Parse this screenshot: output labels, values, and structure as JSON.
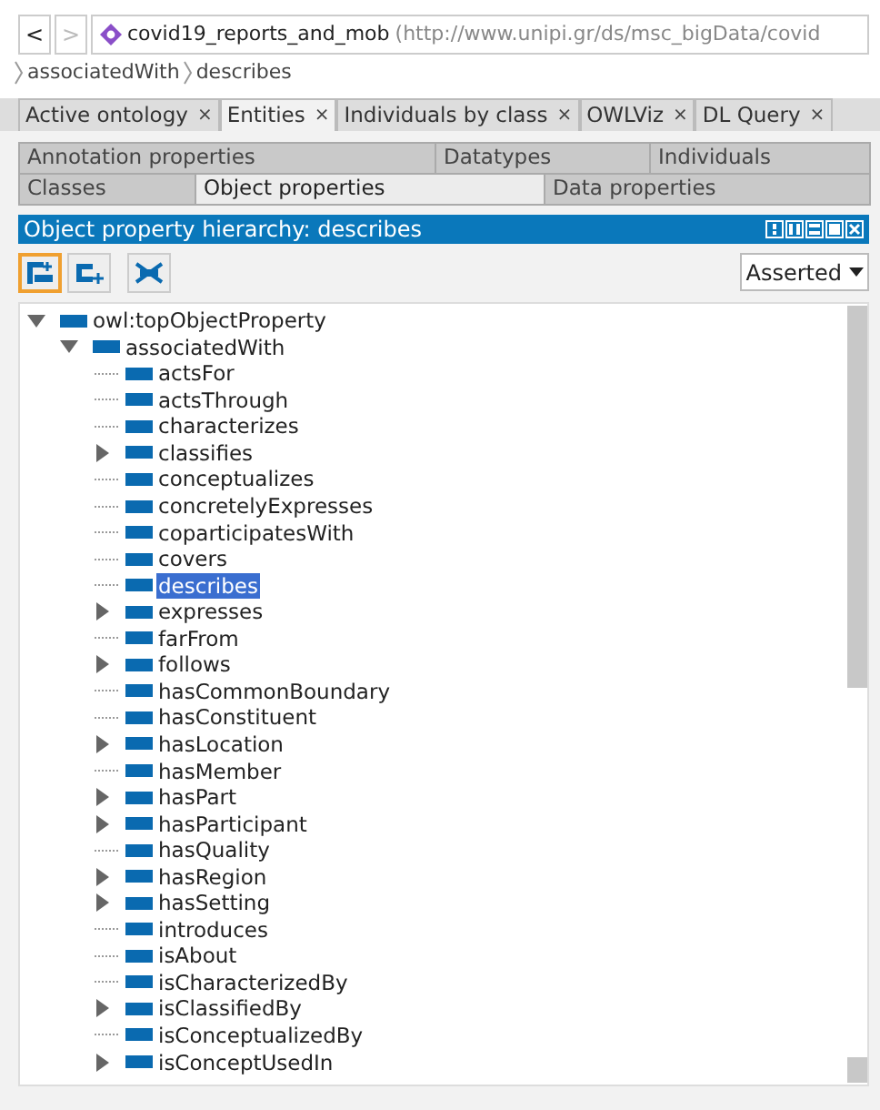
{
  "nav": {
    "buttons": [
      {
        "label": "<",
        "disabled": false
      },
      {
        "label": ">",
        "disabled": true
      }
    ]
  },
  "ontology": {
    "name": "covid19_reports_and_mob",
    "iri": "(http://www.unipi.gr/ds/msc_bigData/covid"
  },
  "breadcrumb": [
    "associatedWith",
    "describes"
  ],
  "tabs": [
    {
      "label": "Active ontology",
      "close": "×",
      "selected": false
    },
    {
      "label": "Entities",
      "close": "×",
      "selected": true
    },
    {
      "label": "Individuals by class",
      "close": "×",
      "selected": false
    },
    {
      "label": "OWLViz",
      "close": "×",
      "selected": false
    },
    {
      "label": "DL Query",
      "close": "×",
      "selected": false
    }
  ],
  "entity_tabs": [
    [
      {
        "label": "Annotation properties",
        "selected": false
      },
      {
        "label": "Datatypes",
        "selected": false
      },
      {
        "label": "Individuals",
        "selected": false
      }
    ],
    [
      {
        "label": "Classes",
        "selected": false
      },
      {
        "label": "Object properties",
        "selected": true
      },
      {
        "label": "Data properties",
        "selected": false
      }
    ]
  ],
  "panel": {
    "title": "Object property hierarchy: describes",
    "toolbar": [
      {
        "kind": "add-sub",
        "selected": true
      },
      {
        "kind": "add-sibling",
        "selected": false
      },
      {
        "kind": "delete",
        "selected": false
      }
    ],
    "mode": "Asserted",
    "tree": [
      {
        "label": "owl:topObjectProperty",
        "kind": "expanded",
        "selected": false,
        "children": [
          {
            "label": "associatedWith",
            "kind": "expanded",
            "selected": false,
            "children": [
              {
                "label": "actsFor",
                "kind": "leaf",
                "selected": false
              },
              {
                "label": "actsThrough",
                "kind": "leaf",
                "selected": false
              },
              {
                "label": "characterizes",
                "kind": "leaf",
                "selected": false
              },
              {
                "label": "classifies",
                "kind": "collapsed",
                "selected": false
              },
              {
                "label": "conceptualizes",
                "kind": "leaf",
                "selected": false
              },
              {
                "label": "concretelyExpresses",
                "kind": "leaf",
                "selected": false
              },
              {
                "label": "coparticipatesWith",
                "kind": "leaf",
                "selected": false
              },
              {
                "label": "covers",
                "kind": "leaf",
                "selected": false
              },
              {
                "label": "describes",
                "kind": "leaf",
                "selected": true
              },
              {
                "label": "expresses",
                "kind": "collapsed",
                "selected": false
              },
              {
                "label": "farFrom",
                "kind": "leaf",
                "selected": false
              },
              {
                "label": "follows",
                "kind": "collapsed",
                "selected": false
              },
              {
                "label": "hasCommonBoundary",
                "kind": "leaf",
                "selected": false
              },
              {
                "label": "hasConstituent",
                "kind": "leaf",
                "selected": false
              },
              {
                "label": "hasLocation",
                "kind": "collapsed",
                "selected": false
              },
              {
                "label": "hasMember",
                "kind": "leaf",
                "selected": false
              },
              {
                "label": "hasPart",
                "kind": "collapsed",
                "selected": false
              },
              {
                "label": "hasParticipant",
                "kind": "collapsed",
                "selected": false
              },
              {
                "label": "hasQuality",
                "kind": "leaf",
                "selected": false
              },
              {
                "label": "hasRegion",
                "kind": "collapsed",
                "selected": false
              },
              {
                "label": "hasSetting",
                "kind": "collapsed",
                "selected": false
              },
              {
                "label": "introduces",
                "kind": "leaf",
                "selected": false
              },
              {
                "label": "isAbout",
                "kind": "leaf",
                "selected": false
              },
              {
                "label": "isCharacterizedBy",
                "kind": "leaf",
                "selected": false
              },
              {
                "label": "isClassifiedBy",
                "kind": "collapsed",
                "selected": false
              },
              {
                "label": "isConceptualizedBy",
                "kind": "leaf",
                "selected": false
              },
              {
                "label": "isConceptUsedIn",
                "kind": "collapsed",
                "selected": false
              }
            ]
          }
        ]
      }
    ]
  }
}
